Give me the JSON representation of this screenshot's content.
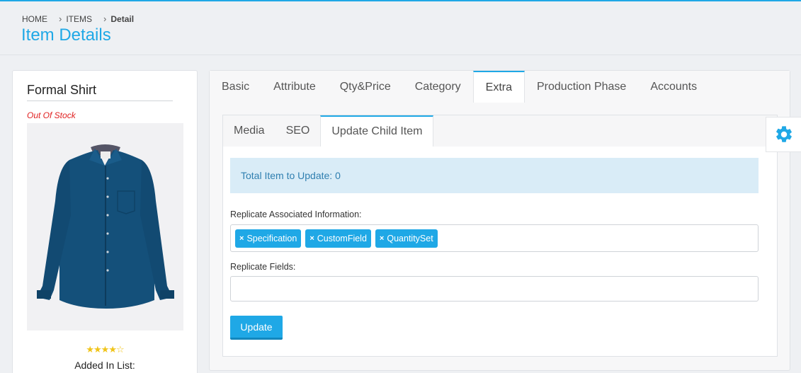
{
  "breadcrumb": {
    "home": "HOME",
    "items": "ITEMS",
    "current": "Detail"
  },
  "page_title": "Item Details",
  "product": {
    "name": "Formal Shirt",
    "stock_status": "Out Of Stock",
    "rating": 4,
    "rating_max": 5,
    "added_in_list": "Added In List:"
  },
  "tabs": [
    "Basic",
    "Attribute",
    "Qty&Price",
    "Category",
    "Extra",
    "Production Phase",
    "Accounts"
  ],
  "active_tab": "Extra",
  "subtabs": [
    "Media",
    "SEO",
    "Update Child Item"
  ],
  "active_subtab": "Update Child Item",
  "update_child": {
    "total_text": "Total Item to Update: 0",
    "replicate_associated_label": "Replicate Associated Information:",
    "associated_tags": [
      "Specification",
      "CustomField",
      "QuantitySet"
    ],
    "tag_remove_glyph": "×",
    "replicate_fields_label": "Replicate Fields:",
    "replicate_fields_value": "",
    "update_button": "Update"
  },
  "colors": {
    "accent": "#1fa8e6",
    "info_bg": "#d9ecf7",
    "out_of_stock": "#e02020"
  },
  "icons": {
    "settings": "gear-icon",
    "breadcrumb_separator": "chevron-right-icon"
  }
}
